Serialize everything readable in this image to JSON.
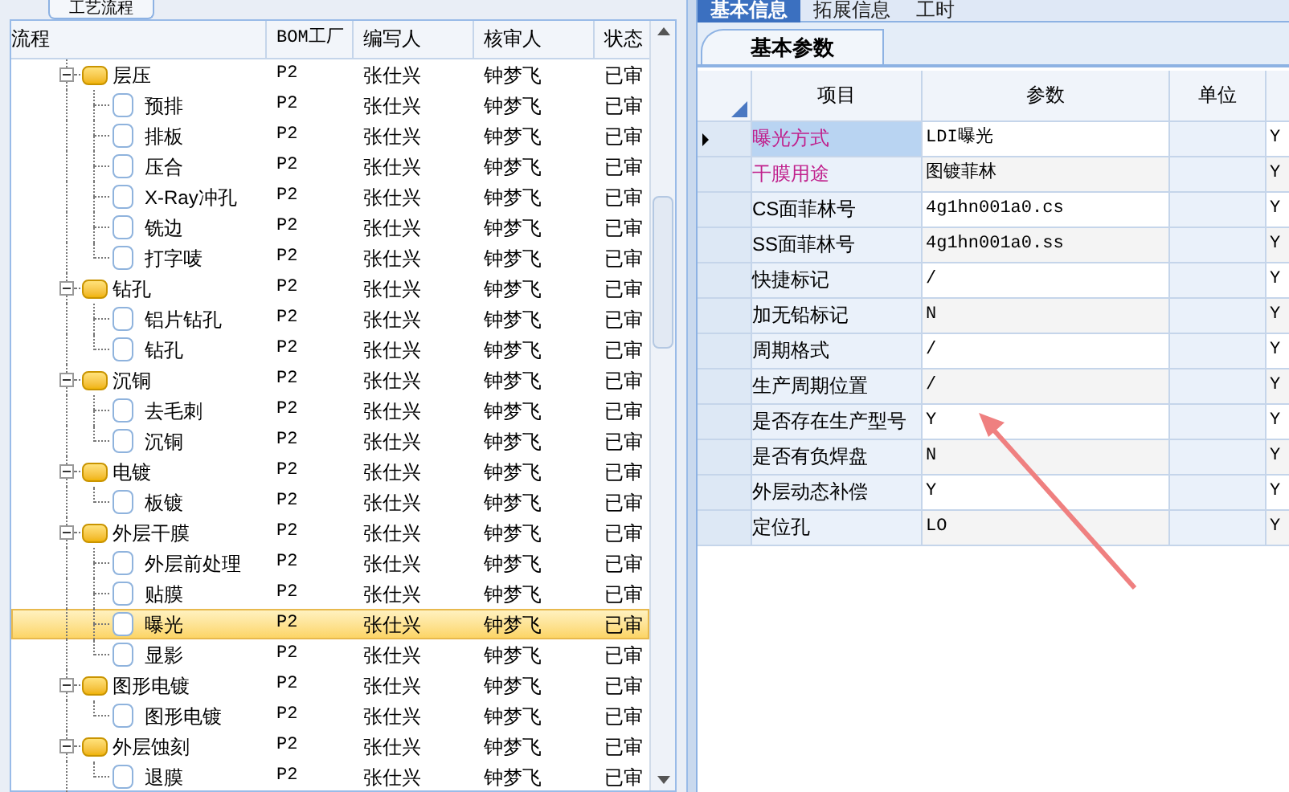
{
  "left_panel": {
    "tab_label": "工艺流程",
    "columns": [
      "流程",
      "BOM工厂",
      "编写人",
      "核审人",
      "状态"
    ],
    "tree": [
      {
        "label": "层压",
        "bom_factory": "P2",
        "writer": "张仕兴",
        "reviewer": "钟梦飞",
        "status": "已审",
        "selected": false,
        "expanded": true,
        "children": [
          {
            "label": "预排",
            "bom_factory": "P2",
            "writer": "张仕兴",
            "reviewer": "钟梦飞",
            "status": "已审",
            "selected": false
          },
          {
            "label": "排板",
            "bom_factory": "P2",
            "writer": "张仕兴",
            "reviewer": "钟梦飞",
            "status": "已审",
            "selected": false
          },
          {
            "label": "压合",
            "bom_factory": "P2",
            "writer": "张仕兴",
            "reviewer": "钟梦飞",
            "status": "已审",
            "selected": false
          },
          {
            "label": "X-Ray冲孔",
            "bom_factory": "P2",
            "writer": "张仕兴",
            "reviewer": "钟梦飞",
            "status": "已审",
            "selected": false
          },
          {
            "label": "铣边",
            "bom_factory": "P2",
            "writer": "张仕兴",
            "reviewer": "钟梦飞",
            "status": "已审",
            "selected": false
          },
          {
            "label": "打字唛",
            "bom_factory": "P2",
            "writer": "张仕兴",
            "reviewer": "钟梦飞",
            "status": "已审",
            "selected": false
          }
        ]
      },
      {
        "label": "钻孔",
        "bom_factory": "P2",
        "writer": "张仕兴",
        "reviewer": "钟梦飞",
        "status": "已审",
        "selected": false,
        "expanded": true,
        "children": [
          {
            "label": "铝片钻孔",
            "bom_factory": "P2",
            "writer": "张仕兴",
            "reviewer": "钟梦飞",
            "status": "已审",
            "selected": false
          },
          {
            "label": "钻孔",
            "bom_factory": "P2",
            "writer": "张仕兴",
            "reviewer": "钟梦飞",
            "status": "已审",
            "selected": false
          }
        ]
      },
      {
        "label": "沉铜",
        "bom_factory": "P2",
        "writer": "张仕兴",
        "reviewer": "钟梦飞",
        "status": "已审",
        "selected": false,
        "expanded": true,
        "children": [
          {
            "label": "去毛刺",
            "bom_factory": "P2",
            "writer": "张仕兴",
            "reviewer": "钟梦飞",
            "status": "已审",
            "selected": false
          },
          {
            "label": "沉铜",
            "bom_factory": "P2",
            "writer": "张仕兴",
            "reviewer": "钟梦飞",
            "status": "已审",
            "selected": false
          }
        ]
      },
      {
        "label": "电镀",
        "bom_factory": "P2",
        "writer": "张仕兴",
        "reviewer": "钟梦飞",
        "status": "已审",
        "selected": false,
        "expanded": true,
        "children": [
          {
            "label": "板镀",
            "bom_factory": "P2",
            "writer": "张仕兴",
            "reviewer": "钟梦飞",
            "status": "已审",
            "selected": false
          }
        ]
      },
      {
        "label": "外层干膜",
        "bom_factory": "P2",
        "writer": "张仕兴",
        "reviewer": "钟梦飞",
        "status": "已审",
        "selected": false,
        "expanded": true,
        "children": [
          {
            "label": "外层前处理",
            "bom_factory": "P2",
            "writer": "张仕兴",
            "reviewer": "钟梦飞",
            "status": "已审",
            "selected": false
          },
          {
            "label": "贴膜",
            "bom_factory": "P2",
            "writer": "张仕兴",
            "reviewer": "钟梦飞",
            "status": "已审",
            "selected": false
          },
          {
            "label": "曝光",
            "bom_factory": "P2",
            "writer": "张仕兴",
            "reviewer": "钟梦飞",
            "status": "已审",
            "selected": true
          },
          {
            "label": "显影",
            "bom_factory": "P2",
            "writer": "张仕兴",
            "reviewer": "钟梦飞",
            "status": "已审",
            "selected": false
          }
        ]
      },
      {
        "label": "图形电镀",
        "bom_factory": "P2",
        "writer": "张仕兴",
        "reviewer": "钟梦飞",
        "status": "已审",
        "selected": false,
        "expanded": true,
        "children": [
          {
            "label": "图形电镀",
            "bom_factory": "P2",
            "writer": "张仕兴",
            "reviewer": "钟梦飞",
            "status": "已审",
            "selected": false
          }
        ]
      },
      {
        "label": "外层蚀刻",
        "bom_factory": "P2",
        "writer": "张仕兴",
        "reviewer": "钟梦飞",
        "status": "已审",
        "selected": false,
        "expanded": true,
        "children": [
          {
            "label": "退膜",
            "bom_factory": "P2",
            "writer": "张仕兴",
            "reviewer": "钟梦飞",
            "status": "已审",
            "selected": false
          }
        ]
      }
    ]
  },
  "right_panel": {
    "tabs": [
      {
        "label": "基本信息",
        "selected": true
      },
      {
        "label": "拓展信息",
        "selected": false
      },
      {
        "label": "工时",
        "selected": false
      }
    ],
    "sub_tab": {
      "label": "基本参数"
    },
    "columns": [
      "项目",
      "参数",
      "单位"
    ],
    "rows": [
      {
        "item": "曝光方式",
        "value": "LDI曝光",
        "flag": "Y",
        "required": true,
        "current": true
      },
      {
        "item": "干膜用途",
        "value": "图镀菲林",
        "flag": "Y",
        "required": true,
        "current": false
      },
      {
        "item": "CS面菲林号",
        "value": "4g1hn001a0.cs",
        "flag": "Y",
        "required": false,
        "current": false
      },
      {
        "item": "SS面菲林号",
        "value": "4g1hn001a0.ss",
        "flag": "Y",
        "required": false,
        "current": false
      },
      {
        "item": "快捷标记",
        "value": "/",
        "flag": "Y",
        "required": false,
        "current": false
      },
      {
        "item": "加无铅标记",
        "value": "N",
        "flag": "Y",
        "required": false,
        "current": false
      },
      {
        "item": "周期格式",
        "value": "/",
        "flag": "Y",
        "required": false,
        "current": false
      },
      {
        "item": "生产周期位置",
        "value": "/",
        "flag": "Y",
        "required": false,
        "current": false
      },
      {
        "item": "是否存在生产型号",
        "value": "Y",
        "flag": "Y",
        "required": false,
        "current": false
      },
      {
        "item": "是否有负焊盘",
        "value": "N",
        "flag": "Y",
        "required": false,
        "current": false
      },
      {
        "item": "外层动态补偿",
        "value": "Y",
        "flag": "Y",
        "required": false,
        "current": false
      },
      {
        "item": "定位孔",
        "value": "LO",
        "flag": "Y",
        "required": false,
        "current": false
      }
    ]
  }
}
